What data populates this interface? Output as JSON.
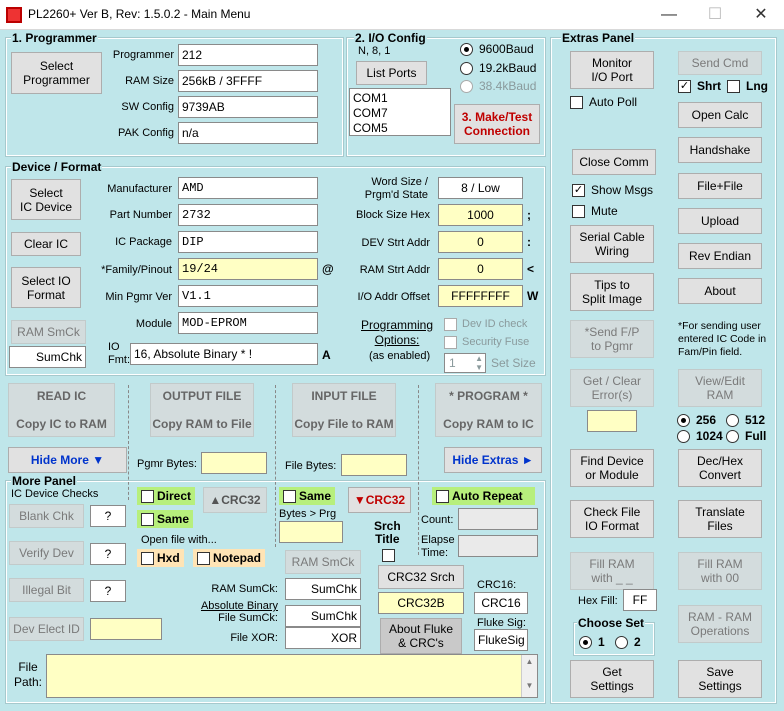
{
  "window": {
    "title": "PL2260+ Ver B, Rev: 1.5.0.2 - Main Menu"
  },
  "programmer": {
    "group_title": "1. Programmer",
    "select_btn": "Select\nProgrammer",
    "programmer_label": "Programmer",
    "programmer_value": "212",
    "ram_size_label": "RAM Size",
    "ram_size_value": "256kB / 3FFFF",
    "sw_config_label": "SW Config",
    "sw_config_value": "9739AB",
    "pak_config_label": "PAK Config",
    "pak_config_value": "n/a"
  },
  "io_config": {
    "group_title": "2. I/O Config",
    "params": "N, 8, 1",
    "list_ports_btn": "List Ports",
    "ports": [
      "COM1",
      "COM7",
      "COM5"
    ],
    "baud_options": [
      "9600Baud",
      "19.2kBaud",
      "38.4kBaud"
    ],
    "make_test_btn": "3. Make/Test\nConnection"
  },
  "extras": {
    "group_title": "Extras Panel",
    "monitor_btn": "Monitor\nI/O Port",
    "auto_poll": "Auto Poll",
    "send_cmd_btn": "Send Cmd",
    "shrt": "Shrt",
    "lng": "Lng",
    "open_calc_btn": "Open Calc",
    "close_comm_btn": "Close Comm",
    "handshake_btn": "Handshake",
    "show_msgs": "Show Msgs",
    "file_plus_file_btn": "File+File",
    "mute": "Mute",
    "upload_btn": "Upload",
    "serial_cable_btn": "Serial Cable\nWiring",
    "rev_endian_btn": "Rev Endian",
    "tips_btn": "Tips to\nSplit Image",
    "about_btn": "About",
    "send_fp_btn": "*Send F/P\nto Pgmr",
    "send_note": "*For sending user entered IC Code in Fam/Pin field.",
    "get_clear_btn": "Get / Clear\nError(s)",
    "view_edit_btn": "View/Edit\nRAM",
    "ram_sizes": [
      "256",
      "512",
      "1024",
      "Full"
    ],
    "find_device_btn": "Find Device\nor Module",
    "dec_hex_btn": "Dec/Hex\nConvert",
    "check_file_btn": "Check File\nIO Format",
    "translate_btn": "Translate\nFiles",
    "fill_ram_btn": "Fill RAM\nwith _ _",
    "fill_ram00_btn": "Fill RAM\nwith 00",
    "hex_fill_label": "Hex Fill:",
    "hex_fill_value": "FF",
    "ram_ram_btn": "RAM - RAM\nOperations",
    "choose_set": "Choose Set",
    "sets": [
      "1",
      "2"
    ],
    "get_settings_btn": "Get\nSettings",
    "save_settings_btn": "Save\nSettings"
  },
  "device": {
    "group_title": "Device / Format",
    "select_ic_btn": "Select\nIC Device",
    "clear_ic_btn": "Clear IC",
    "select_io_btn": "Select IO\nFormat",
    "ram_smck_btn": "RAM SmCk",
    "sumchk_value": "SumChk",
    "manufacturer_label": "Manufacturer",
    "manufacturer_value": "AMD",
    "part_label": "Part Number",
    "part_value": "2732",
    "package_label": "IC Package",
    "package_value": "DIP",
    "family_label": "*Family/Pinout",
    "family_value": "19/24",
    "family_suffix": "@",
    "min_ver_label": "Min Pgmr Ver",
    "min_ver_value": "V1.1",
    "module_label": "Module",
    "module_value": "MOD-EPROM",
    "io_fmt_label": "IO\nFmt:",
    "io_fmt_value": "16, Absolute Binary * !",
    "io_fmt_suffix": "A",
    "word_size_label": "Word Size /\nPrgm'd State",
    "word_size_value": "8 / Low",
    "block_size_label": "Block Size Hex",
    "block_size_value": "1000",
    "block_suffix": ";",
    "dev_strt_label": "DEV Strt Addr",
    "dev_strt_value": "0",
    "dev_suffix": ":",
    "ram_strt_label": "RAM Strt Addr",
    "ram_strt_value": "0",
    "ram_suffix": "<",
    "io_offset_label": "I/O Addr Offset",
    "io_offset_value": "FFFFFFFF",
    "io_suffix": "W",
    "prog_options": "Programming\nOptions:",
    "as_enabled": "(as enabled)",
    "dev_id_check": "Dev ID check",
    "security_fuse": "Security Fuse",
    "set_size_value": "1",
    "set_size_label": "Set Size"
  },
  "actions": {
    "read_ic_title": "READ IC",
    "read_ic_sub": "Copy IC to RAM",
    "output_title": "OUTPUT FILE",
    "output_sub": "Copy RAM to File",
    "input_title": "INPUT FILE",
    "input_sub": "Copy File to RAM",
    "program_title": "* PROGRAM *",
    "program_sub": "Copy RAM to IC",
    "hide_more": "Hide More ▼",
    "pgmr_bytes": "Pgmr Bytes:",
    "file_bytes": "File Bytes:",
    "hide_extras": "Hide Extras ►"
  },
  "more": {
    "group_title": "More Panel",
    "checks_title": "IC Device Checks",
    "blank_btn": "Blank Chk",
    "verify_btn": "Verify Dev",
    "illegal_btn": "Illegal Bit",
    "q": "?",
    "dev_elect_btn": "Dev Elect ID",
    "direct": "Direct",
    "same": "Same",
    "crc32_up": "▲CRC32",
    "open_file_with": "Open file with...",
    "hxd": "Hxd",
    "notepad": "Notepad",
    "same2": "Same",
    "bytes_prg": "Bytes > Prg",
    "crc32_down": "▼CRC32",
    "srch_title": "Srch\nTitle",
    "auto_repeat": "Auto Repeat",
    "count": "Count:",
    "elapse": "Elapse\nTime:",
    "ram_smck2": "RAM SmCk",
    "ram_sumck_label": "RAM SumCk:",
    "ram_sumck_value": "SumChk",
    "abs_bin_label": "Absolute Binary",
    "file_sumck_label": "File SumCk:",
    "file_sumck_value": "SumChk",
    "file_xor_label": "File XOR:",
    "file_xor_value": "XOR",
    "crc32_srch_btn": "CRC32 Srch",
    "crc32b_value": "CRC32B",
    "crc16_label": "CRC16:",
    "crc16_value": "CRC16",
    "fluke_label": "Fluke Sig:",
    "fluke_value": "FlukeSig",
    "about_fluke_btn": "About Fluke\n& CRC's",
    "file_path_label": "File\nPath:"
  }
}
